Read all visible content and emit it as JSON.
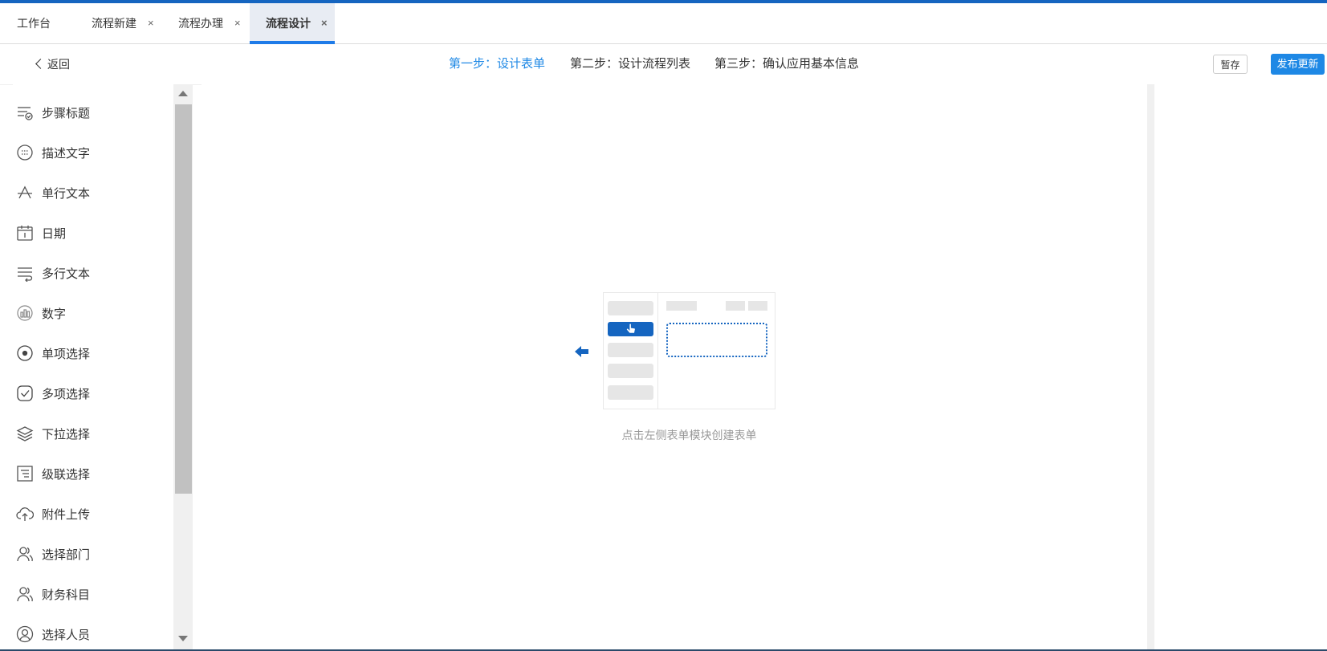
{
  "tabs": [
    {
      "label": "工作台",
      "closable": false,
      "active": false
    },
    {
      "label": "流程新建",
      "closable": true,
      "active": false,
      "close": "×"
    },
    {
      "label": "流程办理",
      "closable": true,
      "active": false,
      "close": "×"
    },
    {
      "label": "流程设计",
      "closable": true,
      "active": true,
      "close": "×"
    }
  ],
  "toolbar": {
    "back_label": "返回",
    "steps": [
      "第一步：设计表单",
      "第二步：设计流程列表",
      "第三步：确认应用基本信息"
    ],
    "active_step": 0,
    "save_label": "暂存",
    "publish_label": "发布更新"
  },
  "sidebar": {
    "items": [
      {
        "label": "步骤标题",
        "icon": "step-title-icon"
      },
      {
        "label": "描述文字",
        "icon": "description-icon"
      },
      {
        "label": "单行文本",
        "icon": "single-line-text-icon"
      },
      {
        "label": "日期",
        "icon": "calendar-icon"
      },
      {
        "label": "多行文本",
        "icon": "multi-line-text-icon"
      },
      {
        "label": "数字",
        "icon": "number-icon"
      },
      {
        "label": "单项选择",
        "icon": "radio-icon"
      },
      {
        "label": "多项选择",
        "icon": "checkbox-icon"
      },
      {
        "label": "下拉选择",
        "icon": "layers-icon"
      },
      {
        "label": "级联选择",
        "icon": "cascade-icon"
      },
      {
        "label": "附件上传",
        "icon": "upload-cloud-icon"
      },
      {
        "label": "选择部门",
        "icon": "department-icon"
      },
      {
        "label": "财务科目",
        "icon": "finance-subject-icon"
      },
      {
        "label": "选择人员",
        "icon": "person-icon"
      }
    ]
  },
  "canvas": {
    "hint": "点击左侧表单模块创建表单"
  },
  "colors": {
    "accent": "#1e88e5",
    "dark_accent": "#1565c0",
    "muted": "#999999"
  }
}
